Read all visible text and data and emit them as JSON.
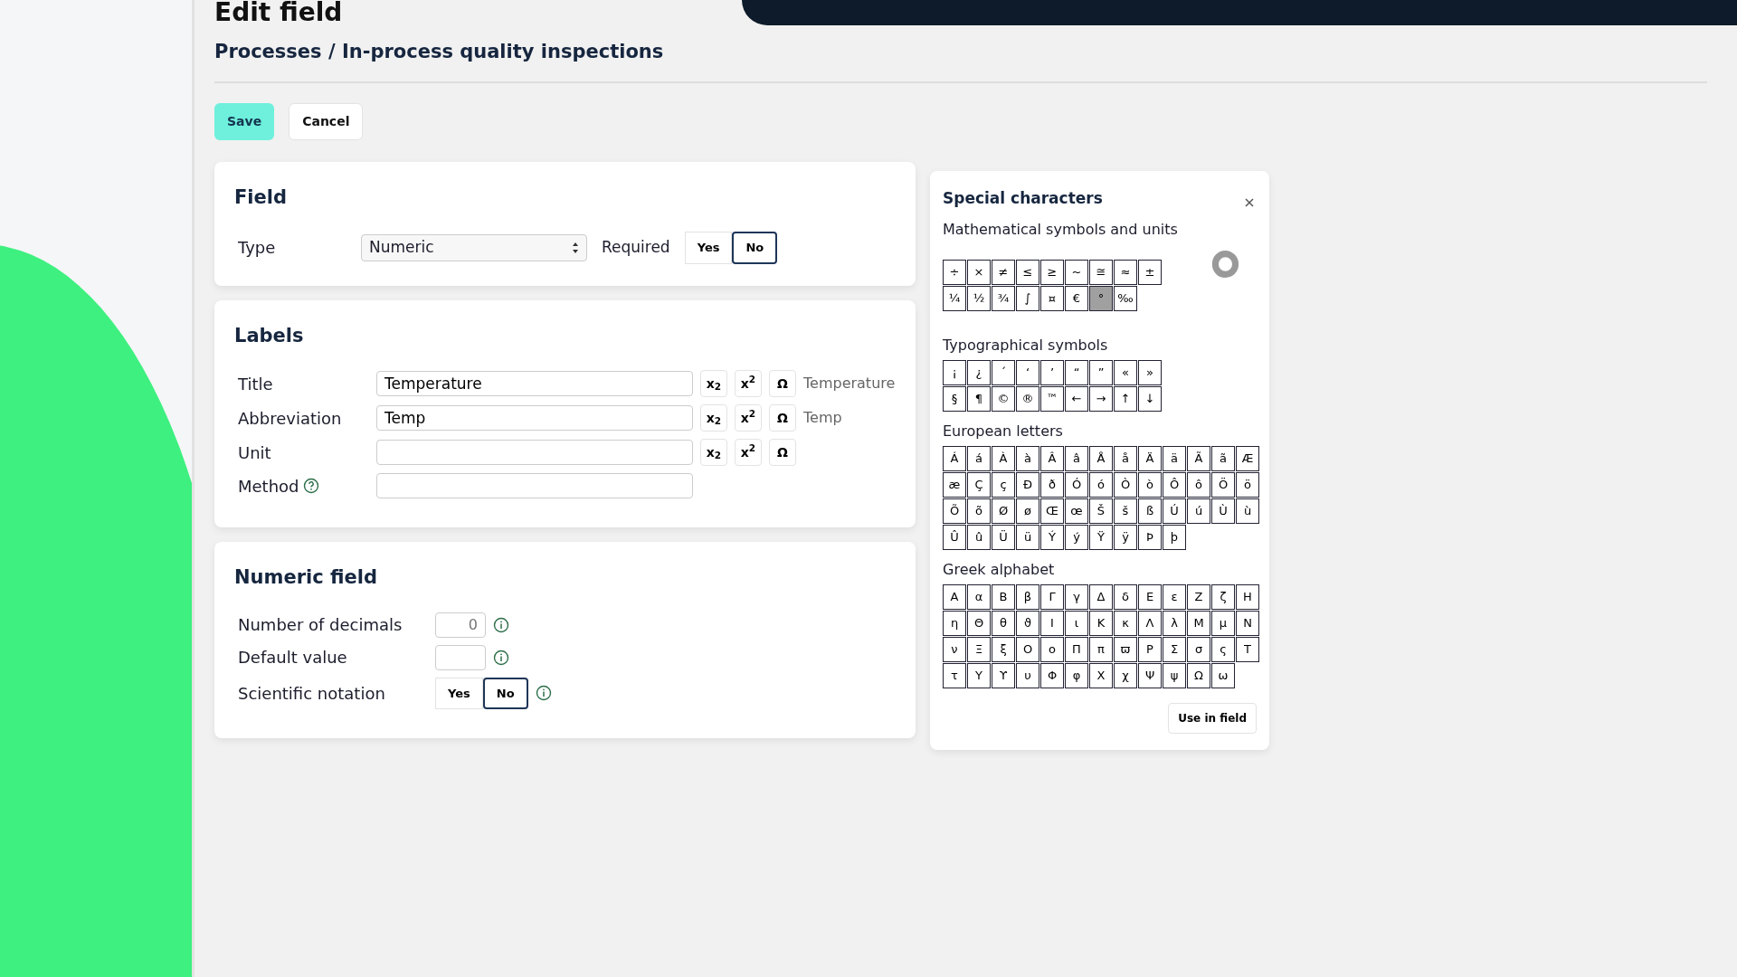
{
  "header": {
    "title": "Edit field",
    "breadcrumb": "Processes / In-process quality inspections"
  },
  "actions": [
    {
      "label": "Save",
      "kind": "primary"
    },
    {
      "label": "Cancel",
      "kind": "secondary"
    }
  ],
  "field_card": {
    "title": "Field",
    "type_label": "Type",
    "type_value": "Numeric",
    "required_label": "Required",
    "required_options": [
      {
        "label": "Yes",
        "selected": false
      },
      {
        "label": "No",
        "selected": true
      }
    ]
  },
  "labels_card": {
    "title": "Labels",
    "rows": [
      {
        "label": "Title",
        "value": "Temperature",
        "tools": [
          "x$_{2}$",
          "x$^{2}$",
          "Ω"
        ],
        "preview": "Temperature",
        "help": false
      },
      {
        "label": "Abbreviation",
        "value": "Temp",
        "tools": [
          "x$_{2}$",
          "x$^{2}$",
          "Ω"
        ],
        "preview": "Temp",
        "help": false
      },
      {
        "label": "Unit",
        "value": "",
        "tools": [
          "x$_{2}$",
          "x$^{2}$",
          "Ω"
        ],
        "help": false
      },
      {
        "label": "Method",
        "value": "",
        "help": true
      }
    ]
  },
  "numeric_card": {
    "title": "Numeric field",
    "rows": [
      {
        "kind": "input",
        "label": "Number of decimals",
        "placeholder": "0"
      },
      {
        "kind": "input",
        "label": "Default value",
        "value": ""
      },
      {
        "kind": "toggle",
        "label": "Scientific notation",
        "options": [
          {
            "label": "Yes",
            "selected": false
          },
          {
            "label": "No",
            "selected": true
          }
        ]
      }
    ]
  },
  "special_characters": {
    "title": "Special characters",
    "preview": "°",
    "button": "Use in field",
    "groups": [
      {
        "title": "Mathematical symbols and units",
        "rows": [
          [
            {
              "c": "÷",
              "selected": false
            },
            {
              "c": "×",
              "selected": false
            },
            {
              "c": "≠",
              "selected": false
            },
            {
              "c": "≤",
              "selected": false
            },
            {
              "c": "≥",
              "selected": false
            },
            {
              "c": "~",
              "selected": false
            },
            {
              "c": "≅",
              "selected": false
            },
            {
              "c": "≈",
              "selected": false
            },
            {
              "c": "±",
              "selected": false
            }
          ],
          [
            {
              "c": "¼",
              "selected": false
            },
            {
              "c": "½",
              "selected": false
            },
            {
              "c": "¾",
              "selected": false
            },
            {
              "c": "∫",
              "selected": false
            },
            {
              "c": "¤",
              "selected": false
            },
            {
              "c": "€",
              "selected": false
            },
            {
              "c": "°",
              "selected": true
            },
            {
              "c": "‰",
              "selected": false
            }
          ]
        ]
      },
      {
        "title": "Typographical symbols",
        "rows": [
          [
            {
              "c": "¡",
              "selected": false
            },
            {
              "c": "¿",
              "selected": false
            },
            {
              "c": "´",
              "selected": false
            },
            {
              "c": "‘",
              "selected": false
            },
            {
              "c": "’",
              "selected": false
            },
            {
              "c": "“",
              "selected": false
            },
            {
              "c": "”",
              "selected": false
            },
            {
              "c": "«",
              "selected": false
            },
            {
              "c": "»",
              "selected": false
            }
          ],
          [
            {
              "c": "§",
              "selected": false
            },
            {
              "c": "¶",
              "selected": false
            },
            {
              "c": "©",
              "selected": false
            },
            {
              "c": "®",
              "selected": false
            },
            {
              "c": "™",
              "selected": false
            },
            {
              "c": "←",
              "selected": false
            },
            {
              "c": "→",
              "selected": false
            },
            {
              "c": "↑",
              "selected": false
            },
            {
              "c": "↓",
              "selected": false
            }
          ]
        ]
      },
      {
        "title": "European letters",
        "rows": [
          [
            {
              "c": "Á",
              "selected": false
            },
            {
              "c": "á",
              "selected": false
            },
            {
              "c": "À",
              "selected": false
            },
            {
              "c": "à",
              "selected": false
            },
            {
              "c": "Â",
              "selected": false
            },
            {
              "c": "â",
              "selected": false
            },
            {
              "c": "Å",
              "selected": false
            },
            {
              "c": "å",
              "selected": false
            },
            {
              "c": "Ä",
              "selected": false
            },
            {
              "c": "ä",
              "selected": false
            },
            {
              "c": "Ã",
              "selected": false
            },
            {
              "c": "ã",
              "selected": false
            },
            {
              "c": "Æ",
              "selected": false
            }
          ],
          [
            {
              "c": "æ",
              "selected": false
            },
            {
              "c": "Ç",
              "selected": false
            },
            {
              "c": "ç",
              "selected": false
            },
            {
              "c": "Ð",
              "selected": false
            },
            {
              "c": "ð",
              "selected": false
            },
            {
              "c": "Ó",
              "selected": false
            },
            {
              "c": "ó",
              "selected": false
            },
            {
              "c": "Ò",
              "selected": false
            },
            {
              "c": "ò",
              "selected": false
            },
            {
              "c": "Ô",
              "selected": false
            },
            {
              "c": "ô",
              "selected": false
            },
            {
              "c": "Ö",
              "selected": false
            },
            {
              "c": "ö",
              "selected": false
            }
          ],
          [
            {
              "c": "Õ",
              "selected": false
            },
            {
              "c": "õ",
              "selected": false
            },
            {
              "c": "Ø",
              "selected": false
            },
            {
              "c": "ø",
              "selected": false
            },
            {
              "c": "Œ",
              "selected": false
            },
            {
              "c": "œ",
              "selected": false
            },
            {
              "c": "Š",
              "selected": false
            },
            {
              "c": "š",
              "selected": false
            },
            {
              "c": "ß",
              "selected": false
            },
            {
              "c": "Ú",
              "selected": false
            },
            {
              "c": "ú",
              "selected": false
            },
            {
              "c": "Ù",
              "selected": false
            },
            {
              "c": "ù",
              "selected": false
            }
          ],
          [
            {
              "c": "Û",
              "selected": false
            },
            {
              "c": "û",
              "selected": false
            },
            {
              "c": "Ü",
              "selected": false
            },
            {
              "c": "ü",
              "selected": false
            },
            {
              "c": "Ý",
              "selected": false
            },
            {
              "c": "ý",
              "selected": false
            },
            {
              "c": "Ÿ",
              "selected": false
            },
            {
              "c": "ÿ",
              "selected": false
            },
            {
              "c": "Þ",
              "selected": false
            },
            {
              "c": "þ",
              "selected": false
            }
          ]
        ]
      },
      {
        "title": "Greek alphabet",
        "rows": [
          [
            {
              "c": "Α",
              "selected": false
            },
            {
              "c": "α",
              "selected": false
            },
            {
              "c": "Β",
              "selected": false
            },
            {
              "c": "β",
              "selected": false
            },
            {
              "c": "Γ",
              "selected": false
            },
            {
              "c": "γ",
              "selected": false
            },
            {
              "c": "Δ",
              "selected": false
            },
            {
              "c": "δ",
              "selected": false
            },
            {
              "c": "Ε",
              "selected": false
            },
            {
              "c": "ε",
              "selected": false
            },
            {
              "c": "Ζ",
              "selected": false
            },
            {
              "c": "ζ",
              "selected": false
            },
            {
              "c": "Η",
              "selected": false
            }
          ],
          [
            {
              "c": "η",
              "selected": false
            },
            {
              "c": "Θ",
              "selected": false
            },
            {
              "c": "θ",
              "selected": false
            },
            {
              "c": "ϑ",
              "selected": false
            },
            {
              "c": "Ι",
              "selected": false
            },
            {
              "c": "ι",
              "selected": false
            },
            {
              "c": "Κ",
              "selected": false
            },
            {
              "c": "κ",
              "selected": false
            },
            {
              "c": "Λ",
              "selected": false
            },
            {
              "c": "λ",
              "selected": false
            },
            {
              "c": "Μ",
              "selected": false
            },
            {
              "c": "μ",
              "selected": false
            },
            {
              "c": "Ν",
              "selected": false
            }
          ],
          [
            {
              "c": "ν",
              "selected": false
            },
            {
              "c": "Ξ",
              "selected": false
            },
            {
              "c": "ξ",
              "selected": false
            },
            {
              "c": "Ο",
              "selected": false
            },
            {
              "c": "ο",
              "selected": false
            },
            {
              "c": "Π",
              "selected": false
            },
            {
              "c": "π",
              "selected": false
            },
            {
              "c": "ϖ",
              "selected": false
            },
            {
              "c": "Ρ",
              "selected": false
            },
            {
              "c": "Σ",
              "selected": false
            },
            {
              "c": "σ",
              "selected": false
            },
            {
              "c": "ς",
              "selected": false
            },
            {
              "c": "Τ",
              "selected": false
            }
          ],
          [
            {
              "c": "τ",
              "selected": false
            },
            {
              "c": "Υ",
              "selected": false
            },
            {
              "c": "ϒ",
              "selected": false
            },
            {
              "c": "υ",
              "selected": false
            },
            {
              "c": "Φ",
              "selected": false
            },
            {
              "c": "φ",
              "selected": false
            },
            {
              "c": "Χ",
              "selected": false
            },
            {
              "c": "χ",
              "selected": false
            },
            {
              "c": "Ψ",
              "selected": false
            },
            {
              "c": "ψ",
              "selected": false
            },
            {
              "c": "Ω",
              "selected": false
            },
            {
              "c": "ω",
              "selected": false
            }
          ]
        ]
      }
    ]
  }
}
